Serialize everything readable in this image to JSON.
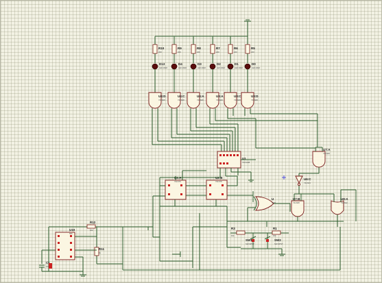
{
  "resistors": [
    {
      "name": "R10",
      "value": "220"
    },
    {
      "name": "R9",
      "value": "220"
    },
    {
      "name": "R8",
      "value": "220"
    },
    {
      "name": "R7",
      "value": "220"
    },
    {
      "name": "R6",
      "value": "220"
    },
    {
      "name": "R5",
      "value": "220"
    }
  ],
  "leds": [
    {
      "name": "D13",
      "type": "LED-RED"
    },
    {
      "name": "D4",
      "type": "LED-RED"
    },
    {
      "name": "D3",
      "type": "LED-RED"
    },
    {
      "name": "D2",
      "type": "LED-RED"
    },
    {
      "name": "D1",
      "type": "LED-RED"
    },
    {
      "name": "D0",
      "type": "LED-RED"
    }
  ],
  "gates": [
    {
      "name": "U4:D",
      "type": "74LS08"
    },
    {
      "name": "U4:C",
      "type": "74LS08"
    },
    {
      "name": "U4:A",
      "type": "74LS08"
    },
    {
      "name": "U3:A",
      "type": "74LS08"
    },
    {
      "name": "U3:C",
      "type": "74LS08"
    },
    {
      "name": "U3:D",
      "type": "74LS08"
    }
  ],
  "decoder": {
    "name": "U1",
    "type": "74LS138"
  },
  "flipflops": [
    {
      "name": "U2:A",
      "type": "74LS76"
    },
    {
      "name": "U2:B",
      "type": "74LS76"
    }
  ],
  "right_gates": [
    {
      "name": "U7:A",
      "type": "74LS08"
    },
    {
      "name": "U6:C",
      "type": "74LS04"
    },
    {
      "name": "U7:B",
      "type": "74LS08"
    },
    {
      "name": "U8:A",
      "type": "74LS32"
    }
  ],
  "xor": {
    "name": "U",
    "type": "4030"
  },
  "switches": [
    {
      "name": "SW1",
      "type": "SW-SPST"
    },
    {
      "name": "SW2",
      "type": "SW-SPST"
    }
  ],
  "small_resistors": [
    {
      "name": "R3",
      "value": "10k"
    },
    {
      "name": "R1",
      "value": "10k"
    }
  ],
  "timer": {
    "name": "U10",
    "type": "555"
  },
  "timer_parts": [
    {
      "name": "R12",
      "value": "10k"
    },
    {
      "name": "R11",
      "value": "1k"
    },
    {
      "name": "C1",
      "value": "10u"
    }
  ]
}
